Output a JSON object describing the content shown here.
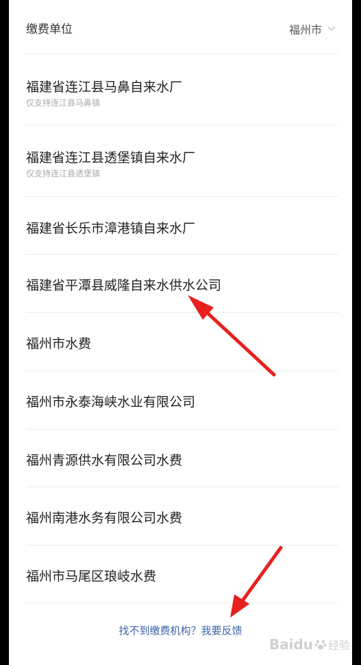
{
  "header": {
    "label": "缴费单位",
    "city": "福州市"
  },
  "items": [
    {
      "title": "福建省连江县马鼻自来水厂",
      "subtitle": "仅支持连江县马鼻镇"
    },
    {
      "title": "福建省连江县透堡镇自来水厂",
      "subtitle": "仅支持连江县透堡镇"
    },
    {
      "title": "福建省长乐市漳港镇自来水厂"
    },
    {
      "title": "福建省平潭县威隆自来水供水公司"
    },
    {
      "title": "福州市水费"
    },
    {
      "title": "福州市永泰海峡水业有限公司"
    },
    {
      "title": "福州青源供水有限公司水费"
    },
    {
      "title": "福州南港水务有限公司水费"
    },
    {
      "title": "福州市马尾区琅岐水费"
    }
  ],
  "footer": {
    "link": "找不到缴费机构？我要反馈"
  },
  "watermark": {
    "brand": "Baidu",
    "sub": "经验"
  },
  "colors": {
    "annotation_arrow": "#e8201e",
    "link": "#3b64a8"
  }
}
